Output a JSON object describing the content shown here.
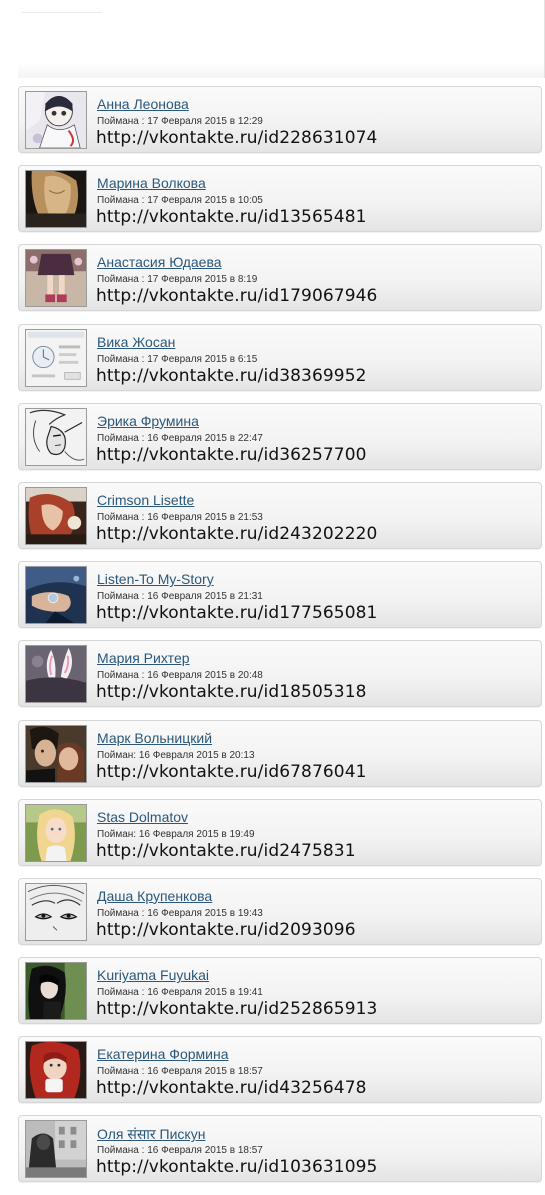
{
  "entries": [
    {
      "name": "Анна Леонова",
      "caught": "Поймана : 17 Февраля 2015 в 12:29",
      "url": "http://vkontakte.ru/id228631074",
      "avatar": "drawing-girl-avatar-icon"
    },
    {
      "name": "Марина Волкова",
      "caught": "Поймана : 17 Февраля 2015 в 10:05",
      "url": "http://vkontakte.ru/id13565481",
      "avatar": "blonde-hair-avatar-icon"
    },
    {
      "name": "Анастасия Юдаева",
      "caught": "Поймана : 17 Февраля 2015 в 8:19",
      "url": "http://vkontakte.ru/id179067946",
      "avatar": "girl-legs-avatar-icon"
    },
    {
      "name": "Вика Жосан",
      "caught": "Поймана : 17 Февраля 2015 в 6:15",
      "url": "http://vkontakte.ru/id38369952",
      "avatar": "window-screenshot-avatar-icon"
    },
    {
      "name": "Эрика Фрумина",
      "caught": "Поймана : 16 Февраля 2015 в 22:47",
      "url": "http://vkontakte.ru/id36257700",
      "avatar": "sketch-elf-avatar-icon"
    },
    {
      "name": "Crimson Lisette",
      "caught": "Поймана : 16 Февраля 2015 в 21:53",
      "url": "http://vkontakte.ru/id243202220",
      "avatar": "red-hair-avatar-icon"
    },
    {
      "name": "Listen-To My-Story",
      "caught": "Поймана : 16 Февраля 2015 в 21:31",
      "url": "http://vkontakte.ru/id177565081",
      "avatar": "hand-ring-avatar-icon"
    },
    {
      "name": "Мария Рихтер",
      "caught": "Поймана : 16 Февраля 2015 в 20:48",
      "url": "http://vkontakte.ru/id18505318",
      "avatar": "bunny-ears-avatar-icon"
    },
    {
      "name": "Марк Вольницкий",
      "caught": "Пойман: 16 Февраля 2015 в 20:13",
      "url": "http://vkontakte.ru/id67876041",
      "avatar": "couple-avatar-icon"
    },
    {
      "name": "Stas Dolmatov",
      "caught": "Пойман: 16 Февраля 2015 в 19:49",
      "url": "http://vkontakte.ru/id2475831",
      "avatar": "blonde-girl-avatar-icon"
    },
    {
      "name": "Даша Крупенкова",
      "caught": "Поймана : 16 Февраля 2015 в 19:43",
      "url": "http://vkontakte.ru/id2093096",
      "avatar": "sketch-eyes-avatar-icon"
    },
    {
      "name": "Kuriyama Fuyukai",
      "caught": "Поймана : 16 Февраля 2015 в 19:41",
      "url": "http://vkontakte.ru/id252865913",
      "avatar": "dark-anime-avatar-icon"
    },
    {
      "name": "Екатерина Формина",
      "caught": "Поймана : 16 Февраля 2015 в 18:57",
      "url": "http://vkontakte.ru/id43256478",
      "avatar": "red-hair-cup-avatar-icon"
    },
    {
      "name": "Оля संसार Пискун",
      "caught": "Поймана : 16 Февраля 2015 в 18:57",
      "url": "http://vkontakte.ru/id103631095",
      "avatar": "street-photo-avatar-icon"
    }
  ],
  "colors": {
    "link": "#2b587a",
    "text": "#333333",
    "url": "#111111",
    "card_border": "#d6d6d6"
  }
}
